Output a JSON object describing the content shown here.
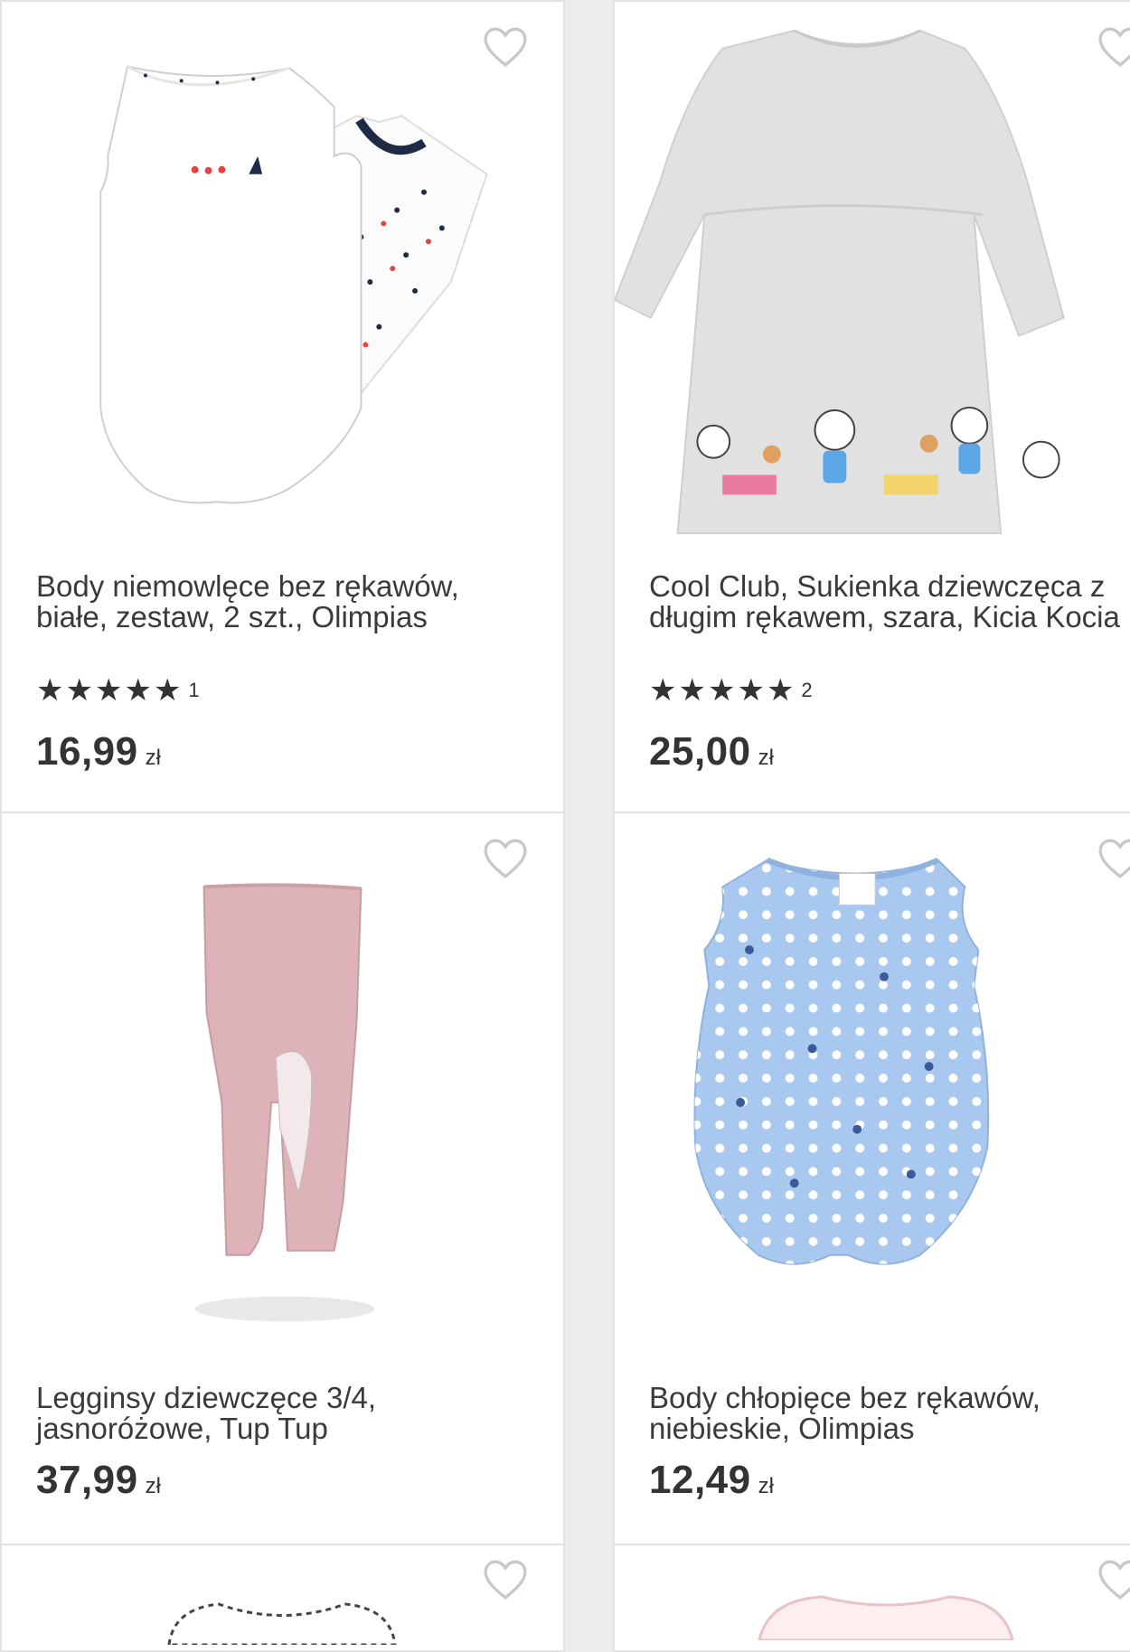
{
  "icons": {
    "favorite": "heart-outline-icon",
    "star": "star-icon"
  },
  "colors": {
    "text": "#3a3a3a",
    "star": "#333333",
    "heart": "#cccccc"
  },
  "products": [
    {
      "title_line1": "Body niemowlęce bez rękawów,",
      "title_line2": "białe, zestaw, 2 szt., Olimpias",
      "rating": 5,
      "rating_count": "1",
      "price": "16,99",
      "currency": "zł"
    },
    {
      "title_line1": "Cool Club, Sukienka dziewczęca z",
      "title_line2": "długim rękawem, szara, Kicia Kocia",
      "rating": 5,
      "rating_count": "2",
      "price": "25,00",
      "currency": "zł"
    },
    {
      "title_line1": "Legginsy dziewczęce 3/4,",
      "title_line2": "jasnoróżowe, Tup Tup",
      "price": "37,99",
      "currency": "zł"
    },
    {
      "title_line1": "Body chłopięce bez rękawów,",
      "title_line2": "niebieskie, Olimpias",
      "price": "12,49",
      "currency": "zł"
    }
  ]
}
